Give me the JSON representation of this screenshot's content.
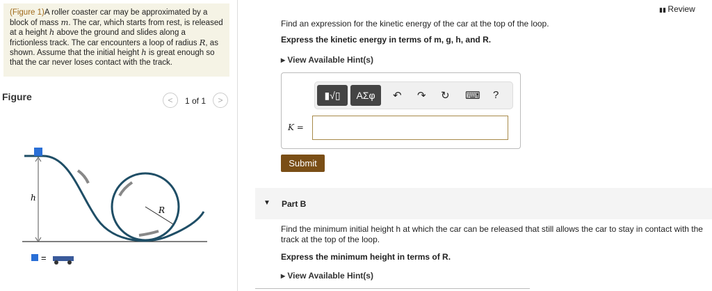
{
  "intro": {
    "figure_link": "(Figure 1)",
    "text_1": "A roller coaster car may be approximated by a block of mass ",
    "m": "m",
    "text_2": ". The car, which starts from rest, is released at a height ",
    "h": "h",
    "text_3": " above the ground and slides along a frictionless track. The car encounters a loop of radius ",
    "R": "R",
    "text_4": ", as shown. Assume that the initial height ",
    "h2": "h",
    "text_5": " is great enough so that the car never loses contact with the track."
  },
  "figure": {
    "title": "Figure",
    "pager": "1 of 1",
    "prev": "<",
    "next": ">",
    "label_h": "h",
    "label_R": "R",
    "legend_eq": "="
  },
  "review": "Review",
  "partA": {
    "question": "Find an expression for the kinetic energy of the car at the top of the loop.",
    "express": "Express the kinetic energy in terms of m, g, h, and R.",
    "hints": "View Available Hint(s)",
    "toolbar": {
      "templates": "▮√▯",
      "symbols": "ΑΣφ",
      "undo": "↶",
      "redo": "↷",
      "reset": "↻",
      "keyboard": "⌨",
      "help": "?"
    },
    "label": "K =",
    "input_value": "",
    "submit": "Submit"
  },
  "partB": {
    "title": "Part B",
    "question": "Find the minimum initial height h at which the car can be released that still allows the car to stay in contact with the track at the top of the loop.",
    "express": "Express the minimum height in terms of R.",
    "hints": "View Available Hint(s)"
  },
  "colors": {
    "accent": "#7a4e16",
    "track": "#1f4e66",
    "block": "#2a6fd6"
  }
}
